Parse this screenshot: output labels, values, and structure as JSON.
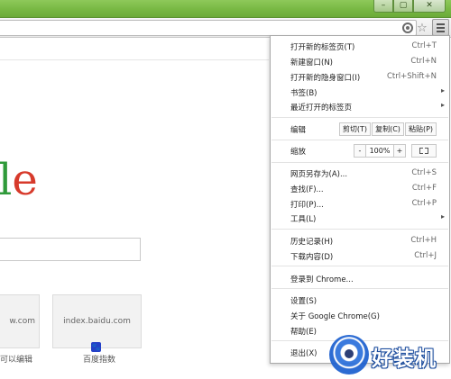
{
  "window_controls": {
    "minimize": "–",
    "maximize": "▢",
    "close": "✕"
  },
  "page": {
    "logo_fragment": [
      "l",
      "e"
    ],
    "tiles": [
      {
        "title": "w.com",
        "caption": "可以编辑"
      },
      {
        "title": "index.baidu.com",
        "caption": "百度指数"
      }
    ],
    "tile_icon_glyph": "🐾"
  },
  "menu": {
    "items": [
      {
        "label": "打开新的标签页(T)",
        "shortcut": "Ctrl+T"
      },
      {
        "label": "新建窗口(N)",
        "shortcut": "Ctrl+N"
      },
      {
        "label": "打开新的隐身窗口(I)",
        "shortcut": "Ctrl+Shift+N"
      },
      {
        "label": "书签(B)",
        "submenu": true
      },
      {
        "label": "最近打开的标签页",
        "submenu": true
      },
      {
        "label": "编辑"
      },
      {
        "label": "缩放"
      },
      {
        "label": "网页另存为(A)...",
        "shortcut": "Ctrl+S"
      },
      {
        "label": "查找(F)...",
        "shortcut": "Ctrl+F"
      },
      {
        "label": "打印(P)...",
        "shortcut": "Ctrl+P"
      },
      {
        "label": "工具(L)",
        "submenu": true
      },
      {
        "label": "历史记录(H)",
        "shortcut": "Ctrl+H"
      },
      {
        "label": "下载内容(D)",
        "shortcut": "Ctrl+J"
      },
      {
        "label": "登录到 Chrome..."
      },
      {
        "label": "设置(S)"
      },
      {
        "label": "关于 Google Chrome(G)"
      },
      {
        "label": "帮助(E)"
      },
      {
        "label": "退出(X)"
      }
    ],
    "edit_buttons": {
      "cut": "剪切(T)",
      "copy": "复制(C)",
      "paste": "粘贴(P)"
    },
    "zoom": {
      "minus": "-",
      "value": "100%",
      "plus": "+"
    },
    "submenu_arrow": "▸"
  },
  "watermark": {
    "text": "好装机"
  },
  "colors": {
    "titlebar": "#77b742",
    "logo_l": "#2f9a3a",
    "logo_e": "#d73a2b",
    "baidu_icon": "#2440c8"
  },
  "icons": [
    "extension-icon",
    "star-icon",
    "menu-icon",
    "fullscreen-icon",
    "baidu-paw-icon",
    "watermark-logo"
  ]
}
